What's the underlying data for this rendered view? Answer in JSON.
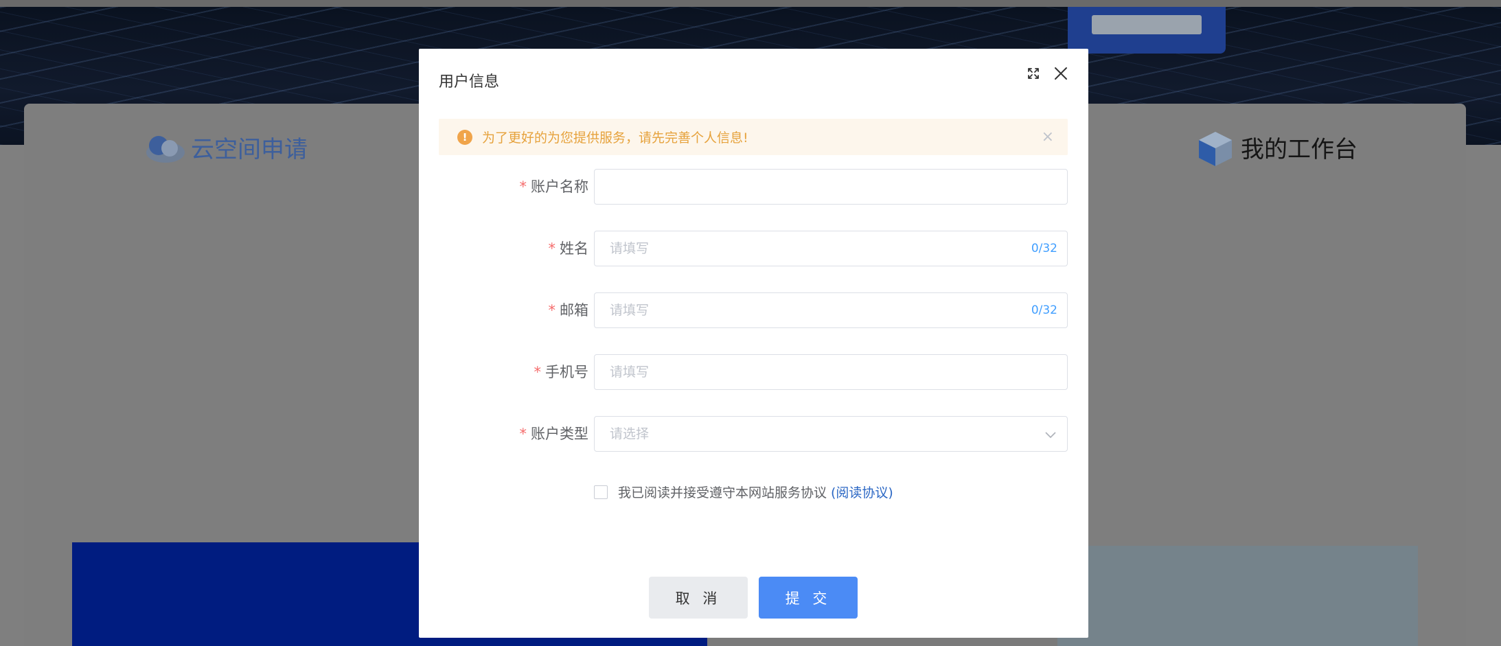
{
  "background": {
    "left_title": "云空间申请",
    "right_title": "我的工作台"
  },
  "dialog": {
    "title": "用户信息",
    "alert_text": "为了更好的为您提供服务，请先完善个人信息!",
    "fields": {
      "account_name": {
        "label": "账户名称",
        "value": ""
      },
      "name": {
        "label": "姓名",
        "placeholder": "请填写",
        "counter": "0/32"
      },
      "email": {
        "label": "邮箱",
        "placeholder": "请填写",
        "counter": "0/32"
      },
      "phone": {
        "label": "手机号",
        "placeholder": "请填写"
      },
      "account_type": {
        "label": "账户类型",
        "placeholder": "请选择"
      }
    },
    "agreement_text": "我已阅读并接受遵守本网站服务协议",
    "agreement_link": "(阅读协议)",
    "cancel_label": "取 消",
    "submit_label": "提 交"
  },
  "colors": {
    "primary": "#4b8bf5",
    "warning": "#e6a23c",
    "required": "#f56c6c"
  }
}
